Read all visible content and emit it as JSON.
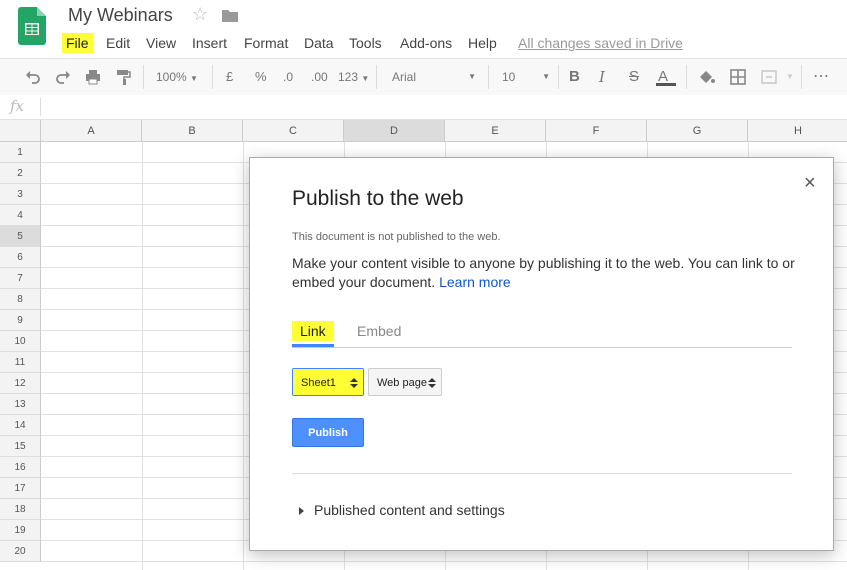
{
  "header": {
    "title": "My Webinars",
    "menus": [
      "File",
      "Edit",
      "View",
      "Insert",
      "Format",
      "Data",
      "Tools",
      "Add-ons",
      "Help"
    ],
    "saved_status": "All changes saved in Drive"
  },
  "toolbar": {
    "zoom": "100%",
    "currency": "£",
    "percent": "%",
    "dec_decrease": ".0",
    "dec_increase": ".00",
    "more_formats": "123",
    "font": "Arial",
    "font_size": "10",
    "bold": "B",
    "italic": "I",
    "strike": "S",
    "text_color": "A",
    "more": "⋯"
  },
  "formula_bar": {
    "fx": "fx"
  },
  "grid": {
    "columns": [
      "A",
      "B",
      "C",
      "D",
      "E",
      "F",
      "G",
      "H"
    ],
    "rows": [
      "1",
      "2",
      "3",
      "4",
      "5",
      "6",
      "7",
      "8",
      "9",
      "10",
      "11",
      "12",
      "13",
      "14",
      "15",
      "16",
      "17",
      "18",
      "19",
      "20"
    ]
  },
  "dialog": {
    "title": "Publish to the web",
    "close": "×",
    "status": "This document is not published to the web.",
    "description": "Make your content visible to anyone by publishing it to the web. You can link to or embed your document.",
    "learn_more": "Learn more",
    "tab_link": "Link",
    "tab_embed": "Embed",
    "sheet_select": "Sheet1",
    "format_select": "Web page",
    "publish_button": "Publish",
    "published_settings": "Published content and settings"
  },
  "colors": {
    "highlight": "#ffff33",
    "accent": "#4285f4",
    "publish": "#4d90fe",
    "sheets_green": "#0f9d58"
  }
}
